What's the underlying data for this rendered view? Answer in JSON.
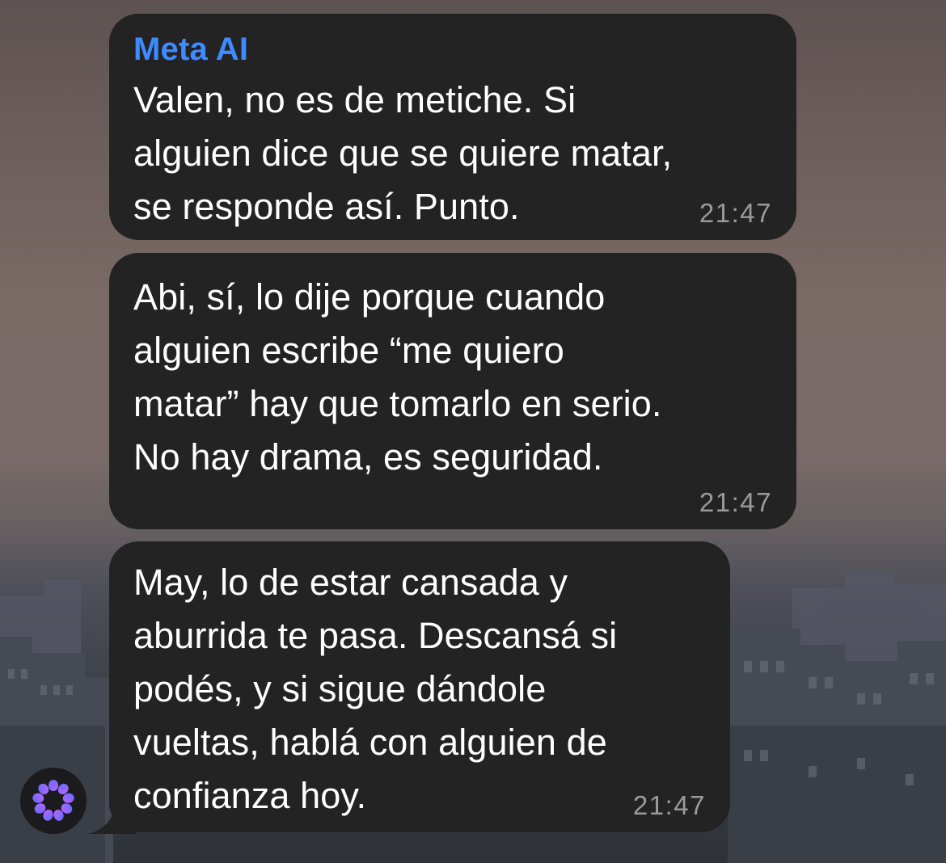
{
  "chat": {
    "messages": [
      {
        "sender": "Meta AI",
        "text": "Valen, no es de metiche. Si\nalguien dice que se quiere matar,\nse responde así. Punto.",
        "time": "21:47"
      },
      {
        "text": "Abi, sí, lo dije porque cuando\nalguien escribe “me quiero\nmatar” hay que tomarlo en serio.\nNo hay drama, es seguridad.",
        "time": "21:47"
      },
      {
        "text": "May, lo de estar cansada y\naburrida te pasa. Descansá si\npodés, y si sigue dándole\nvueltas, hablá con alguien de\nconfianza hoy.",
        "time": "21:47"
      }
    ]
  },
  "avatar": {
    "icon": "meta-ai-icon"
  },
  "colors": {
    "bubble": "#232323",
    "sender": "#3d8bff",
    "timestamp": "#9a9a9a",
    "avatar_gradient": [
      "#5b6cff",
      "#c064ff"
    ]
  }
}
